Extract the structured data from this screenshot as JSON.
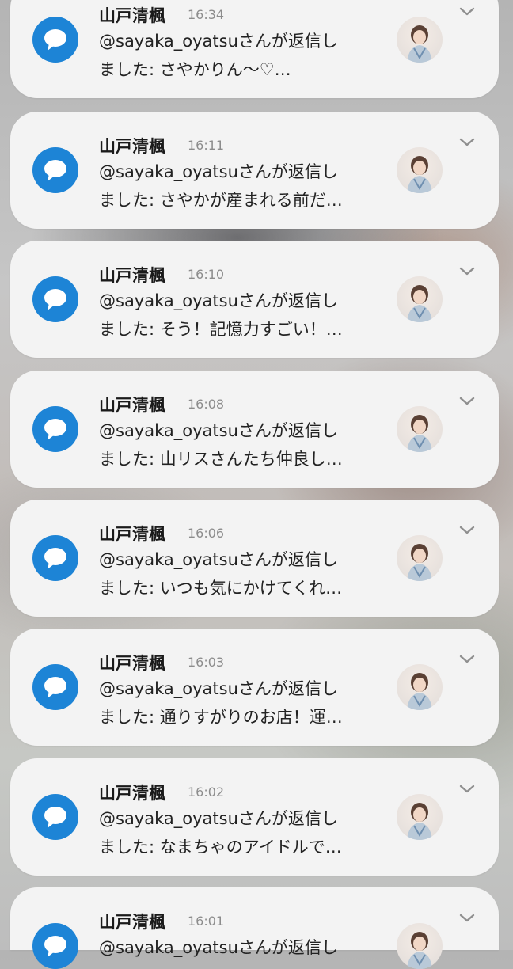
{
  "notifications": [
    {
      "sender": "山戸清楓",
      "time": "16:34",
      "line1": "@sayaka_oyatsuさんが返信し",
      "line2": "ました: さやかりん〜♡…"
    },
    {
      "sender": "山戸清楓",
      "time": "16:11",
      "line1": "@sayaka_oyatsuさんが返信し",
      "line2": "ました: さやかが産まれる前だ…"
    },
    {
      "sender": "山戸清楓",
      "time": "16:10",
      "line1": "@sayaka_oyatsuさんが返信し",
      "line2": "ました: そう！記憶力すごい！…"
    },
    {
      "sender": "山戸清楓",
      "time": "16:08",
      "line1": "@sayaka_oyatsuさんが返信し",
      "line2": "ました: 山リスさんたち仲良し…"
    },
    {
      "sender": "山戸清楓",
      "time": "16:06",
      "line1": "@sayaka_oyatsuさんが返信し",
      "line2": "ました: いつも気にかけてくれ…"
    },
    {
      "sender": "山戸清楓",
      "time": "16:03",
      "line1": "@sayaka_oyatsuさんが返信し",
      "line2": "ました: 通りすがりのお店！運…"
    },
    {
      "sender": "山戸清楓",
      "time": "16:02",
      "line1": "@sayaka_oyatsuさんが返信し",
      "line2": "ました: なまちゃのアイドルで…"
    },
    {
      "sender": "山戸清楓",
      "time": "16:01",
      "line1": "@sayaka_oyatsuさんが返信し",
      "line2": ""
    }
  ],
  "colors": {
    "app_icon_blue": "#1d84d6",
    "card_background": "#f3f3f3",
    "time_gray": "#8c8c8c"
  },
  "icons": {
    "app": "speech-bubble-icon",
    "expand": "chevron-down-icon",
    "avatar": "avatar"
  }
}
